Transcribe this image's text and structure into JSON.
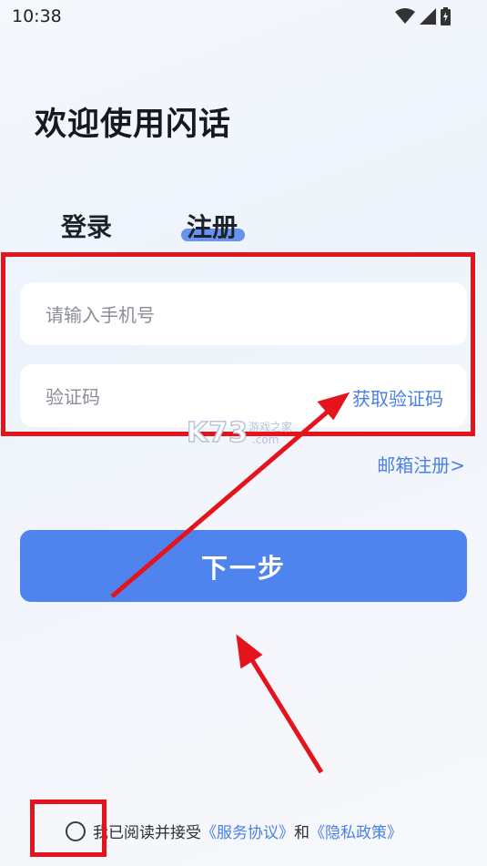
{
  "status_bar": {
    "time": "10:38"
  },
  "header": {
    "title": "欢迎使用闪话"
  },
  "tabs": {
    "login_label": "登录",
    "register_label": "注册",
    "active": "注册"
  },
  "form": {
    "phone_placeholder": "请输入手机号",
    "code_placeholder": "验证码",
    "get_code_label": "获取验证码"
  },
  "email_register_label": "邮箱注册>",
  "next_button_label": "下一步",
  "watermark": {
    "brand": "K73",
    "sub": "游戏之家",
    "domain": ".com"
  },
  "agreement": {
    "prefix": "我已阅读并接受",
    "service_link": "《服务协议》",
    "and": "和",
    "privacy_link": "《隐私政策》",
    "checked": false
  },
  "colors": {
    "accent": "#4f84ee",
    "link": "#4a7fe6",
    "highlight": "#e5141c"
  }
}
